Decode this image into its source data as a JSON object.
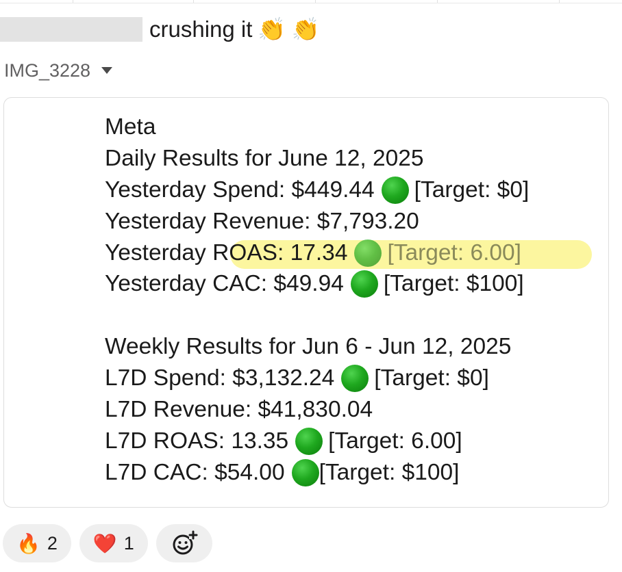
{
  "message": {
    "text": "crushing it",
    "emoji": [
      "👏",
      "👏"
    ]
  },
  "attachment": {
    "name": "IMG_3228",
    "toggle_icon": "caret-down-icon"
  },
  "report": {
    "title": "Meta",
    "daily_heading": "Daily Results for June 12, 2025",
    "daily": [
      {
        "label": "Yesterday Spend: $449.44",
        "status": "green",
        "target": "[Target: $0]"
      },
      {
        "label": "Yesterday Revenue: $7,793.20"
      },
      {
        "label": "Yesterday ROAS: 17.34",
        "status": "green",
        "target": "[Target: 6.00]",
        "highlighted": true
      },
      {
        "label": "Yesterday CAC: $49.94",
        "status": "green",
        "target": "[Target: $100]"
      }
    ],
    "weekly_heading": "Weekly Results for Jun 6 - Jun 12, 2025",
    "weekly": [
      {
        "label": "L7D Spend: $3,132.24",
        "status": "green",
        "target": "[Target: $0]"
      },
      {
        "label": "L7D Revenue: $41,830.04"
      },
      {
        "label": "L7D ROAS: 13.35",
        "status": "green",
        "target": "[Target: 6.00]"
      },
      {
        "label": "L7D CAC: $54.00",
        "status": "green",
        "target": "[Target: $100]"
      }
    ],
    "status_color": "#1fa81f",
    "highlight_color": "#faee50"
  },
  "reactions": [
    {
      "emoji": "🔥",
      "count": "2",
      "icon": "fire-icon"
    },
    {
      "emoji": "❤️",
      "count": "1",
      "icon": "heart-icon"
    }
  ],
  "add_reaction_icon": "add-reaction-icon"
}
